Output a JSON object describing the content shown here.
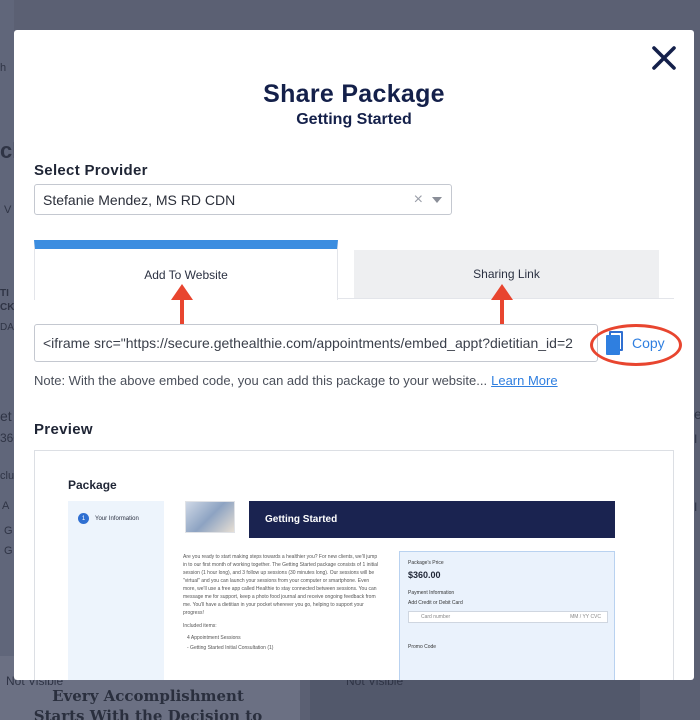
{
  "background": {
    "fragments": [
      "h",
      "ck",
      "V",
      "TI",
      "CKA",
      "DA",
      "et",
      "360",
      "clu",
      "A",
      "G",
      "G",
      "et",
      "I",
      "I"
    ],
    "not_visible_left": "Not Visible",
    "not_visible_right": "Not Visible",
    "quote_line1": "Every Accomplishment",
    "quote_line2": "Starts With the Decision to"
  },
  "modal": {
    "title": "Share Package",
    "subtitle": "Getting Started",
    "close_icon": "close-icon"
  },
  "provider": {
    "label": "Select Provider",
    "value": "Stefanie Mendez, MS RD CDN",
    "clear_glyph": "×"
  },
  "tabs": [
    {
      "label": "Add To Website",
      "active": true
    },
    {
      "label": "Sharing Link",
      "active": false
    }
  ],
  "embed": {
    "code": "<iframe src=\"https://secure.gethealthie.com/appointments/embed_appt?dietitian_id=2",
    "copy_label": "Copy",
    "note": "Note: With the above embed code, you can add this package to your website...",
    "learn_more": "Learn More"
  },
  "annotation_colors": {
    "arrow": "#e8452f",
    "circle": "#e8452f"
  },
  "preview": {
    "label": "Preview",
    "heading": "Package",
    "step_number": "1",
    "step_label": "Your Information",
    "banner_title": "Getting Started",
    "description": "Are you ready to start making steps towards a healthier you? For new clients, we'll jump in to our first month of working together. The Getting Started package consists of 1 initial session (1 hour long), and 3 follow up sessions (30 minutes long). Our sessions will be \"virtual\" and you can launch your sessions from your computer or smartphone. Even more, we'll use a free app called Healthie to stay connected between sessions. You can message me for support, keep a photo food journal and receive ongoing feedback from me. You'll have a dietitian in your pocket wherever you go, helping to support your progress!",
    "included_title": "Included items:",
    "included_items": [
      "4 Appointment Sessions",
      "- Getting Started Initial Consultation (1)"
    ],
    "price_label": "Package's Price",
    "price": "$360.00",
    "payment_info": "Payment Information",
    "card_label": "Add Credit or Debit Card",
    "card_placeholder": "Card number",
    "card_exp": "MM / YY  CVC",
    "promo_label": "Promo Code"
  }
}
